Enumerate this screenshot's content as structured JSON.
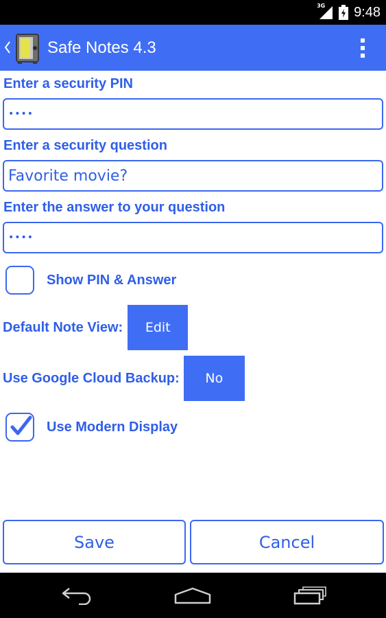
{
  "status_bar": {
    "network_type": "3G",
    "time": "9:48"
  },
  "action_bar": {
    "title": "Safe Notes 4.3"
  },
  "form": {
    "pin_label": "Enter a security PIN",
    "pin_value": "••••",
    "question_label": "Enter a security question",
    "question_value": "Favorite movie?",
    "answer_label": "Enter the answer to your question",
    "answer_value": "••••",
    "show_pin_label": "Show PIN & Answer",
    "show_pin_checked": false,
    "default_view_label": "Default Note View:",
    "default_view_value": "Edit",
    "cloud_backup_label": "Use Google Cloud Backup:",
    "cloud_backup_value": "No",
    "modern_display_label": "Use Modern Display",
    "modern_display_checked": true
  },
  "buttons": {
    "save": "Save",
    "cancel": "Cancel"
  },
  "colors": {
    "accent": "#3f6ef5",
    "text_accent": "#2f5ee8",
    "bars": "#000000",
    "background": "#ffffff"
  },
  "icons": {
    "status": [
      "signal-icon",
      "battery-icon"
    ],
    "action_bar": [
      "back-caret-icon",
      "safe-app-icon",
      "overflow-menu-icon"
    ],
    "nav": [
      "back-icon",
      "home-icon",
      "recent-apps-icon"
    ]
  }
}
